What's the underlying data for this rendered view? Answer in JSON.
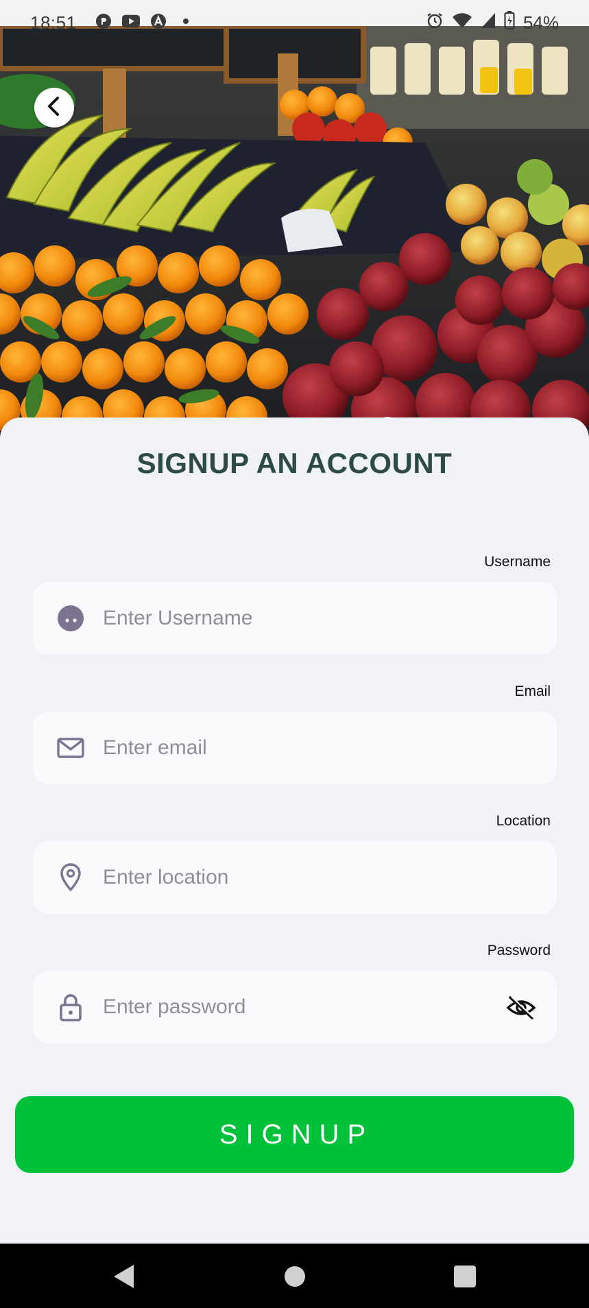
{
  "status_bar": {
    "time": "18:51",
    "battery": "54%",
    "left_icons": [
      "p-app-icon",
      "youtube-icon",
      "a-app-icon",
      "dot-icon"
    ],
    "right_icons": [
      "alarm-icon",
      "wifi-icon",
      "signal-icon",
      "battery-icon"
    ]
  },
  "header": {
    "back_icon": "chevron-left-icon"
  },
  "form": {
    "title": "SIGNUP AN ACCOUNT",
    "username": {
      "label": "Username",
      "placeholder": "Enter Username",
      "value": "",
      "icon": "user-face-icon"
    },
    "email": {
      "label": "Email",
      "placeholder": "Enter email",
      "value": "",
      "icon": "envelope-icon"
    },
    "location": {
      "label": "Location",
      "placeholder": "Enter location",
      "value": "",
      "icon": "location-pin-icon"
    },
    "password": {
      "label": "Password",
      "placeholder": "Enter password",
      "value": "",
      "icon": "lock-icon",
      "toggle_icon": "eye-off-icon"
    },
    "submit_label": "SIGNUP"
  },
  "colors": {
    "accent": "#00c23a",
    "title": "#2d4a47",
    "card_bg": "#f1f2f7",
    "field_bg": "#fafafc",
    "icon": "#7b7390"
  },
  "nav_bar": {
    "icons": [
      "nav-back-icon",
      "nav-home-icon",
      "nav-recents-icon"
    ]
  }
}
